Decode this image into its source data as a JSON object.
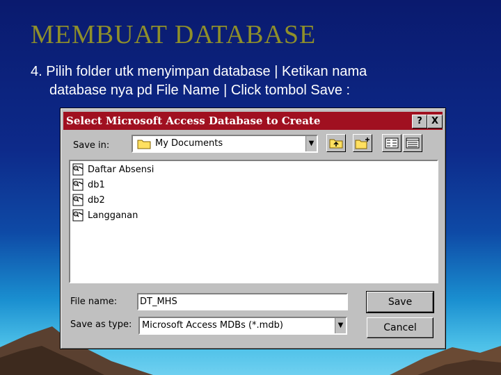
{
  "slide": {
    "title": "MEMBUAT  DATABASE",
    "step_number": "4.",
    "line1": "Pilih folder utk menyimpan database  | Ketikan nama",
    "line2": "database nya pd File Name | Click tombol Save :"
  },
  "dialog": {
    "title": "Select Microsoft Access Database to Create",
    "help_label": "?",
    "close_label": "X",
    "save_in_label": "Save in:",
    "save_in_value": "My Documents",
    "files": [
      {
        "name": "Daftar Absensi"
      },
      {
        "name": "db1"
      },
      {
        "name": "db2"
      },
      {
        "name": "Langganan"
      }
    ],
    "file_name_label": "File name:",
    "file_name_value": "DT_MHS",
    "save_as_type_label": "Save as type:",
    "save_as_type_value": "Microsoft Access MDBs (*.mdb)",
    "save_button": "Save",
    "cancel_button": "Cancel"
  },
  "colors": {
    "title_bar": "#a01020",
    "slide_title": "#8f8f2a"
  }
}
